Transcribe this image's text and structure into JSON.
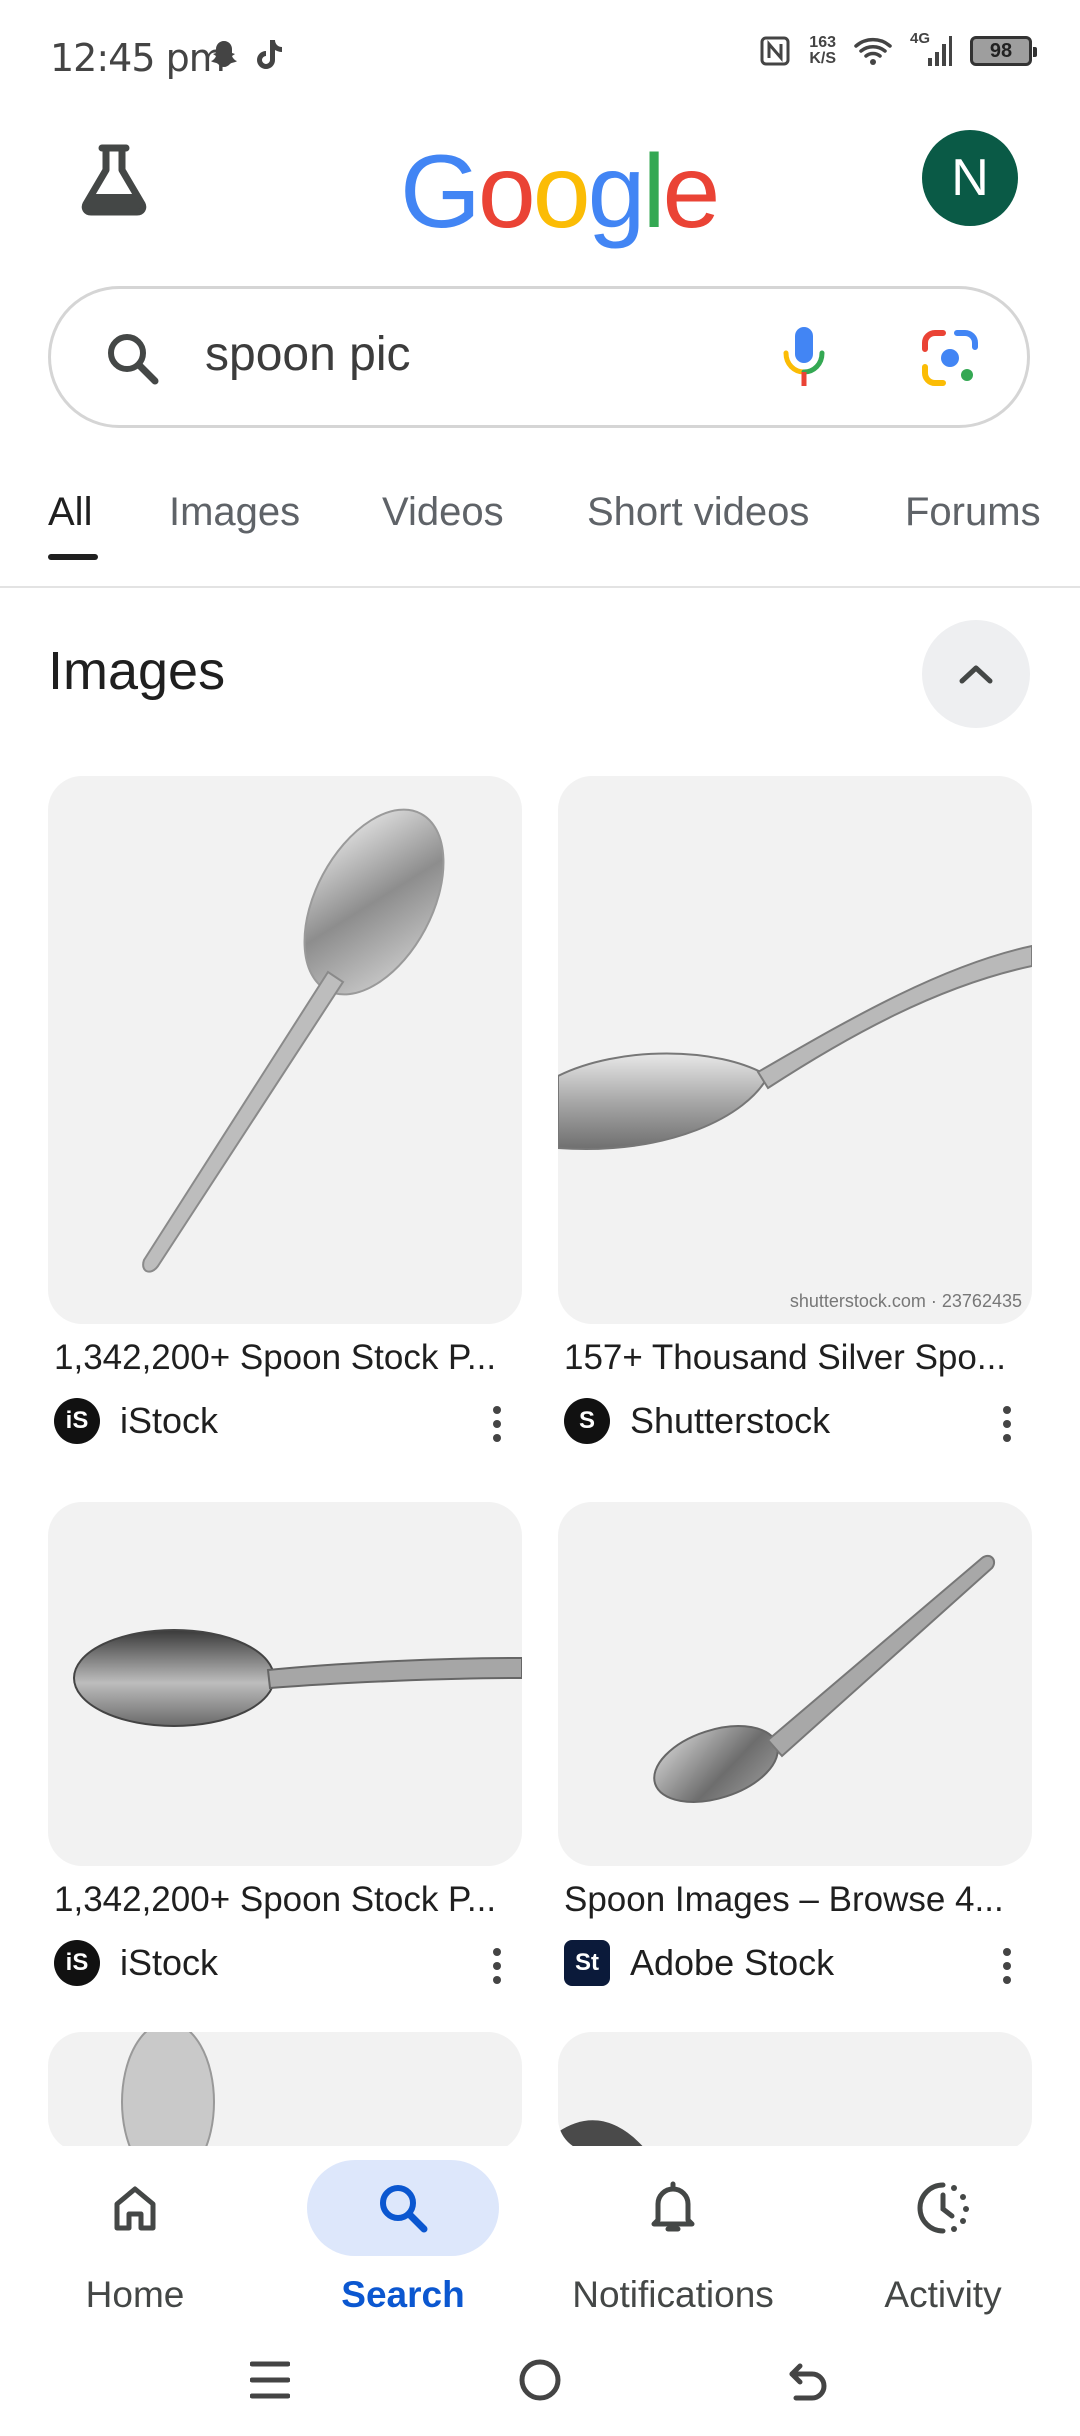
{
  "status_bar": {
    "time": "12:45 pm",
    "net_speed_value": "163",
    "net_speed_unit": "K/S",
    "network": "4G",
    "battery": "98"
  },
  "header": {
    "logo_letters": [
      "G",
      "o",
      "o",
      "g",
      "l",
      "e"
    ],
    "logo_colors": [
      "#4285F4",
      "#EA4335",
      "#FBBC05",
      "#4285F4",
      "#34A853",
      "#EA4335"
    ],
    "avatar_initial": "N",
    "avatar_color": "#0a5a46"
  },
  "search": {
    "query": "spoon pic"
  },
  "tabs": [
    "All",
    "Images",
    "Videos",
    "Short videos",
    "Forums"
  ],
  "active_tab": "All",
  "images_section": {
    "title": "Images",
    "results": [
      {
        "title": "1,342,200+ Spoon Stock P...",
        "source": "iStock",
        "source_logo": "iS"
      },
      {
        "title": "157+ Thousand Silver Spo...",
        "source": "Shutterstock",
        "source_logo": "S",
        "watermark": "shutterstock.com · 2376243​5"
      },
      {
        "title": "1,342,200+ Spoon Stock P...",
        "source": "iStock",
        "source_logo": "iS"
      },
      {
        "title": "Spoon Images – Browse 4...",
        "source": "Adobe Stock",
        "source_logo": "St"
      }
    ]
  },
  "bottom_nav": {
    "items": [
      "Home",
      "Search",
      "Notifications",
      "Activity"
    ],
    "active": "Search",
    "accent": "#0b57d0"
  }
}
